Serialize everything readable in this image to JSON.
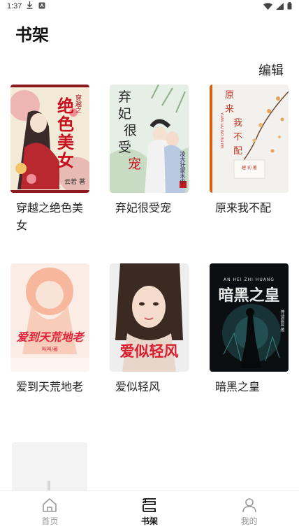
{
  "status_bar": {
    "time": "1:37"
  },
  "header": {
    "title": "书架",
    "edit_label": "编辑"
  },
  "books": [
    {
      "title": "穿越之绝色美女",
      "cover_text": [
        "绝",
        "色",
        "美",
        "女"
      ],
      "cover_top": "穿越之",
      "cover_author": "云若 著"
    },
    {
      "title": "弃妃很受宠",
      "cover_text": [
        "弃",
        "妃",
        "很",
        "受",
        "宠"
      ],
      "cover_side": "凌大壮家木中"
    },
    {
      "title": "原来我不配",
      "cover_text": [
        "原",
        "来",
        "我",
        "不",
        "配"
      ],
      "cover_pinyin": "YUAN LAI WO BU PEI",
      "cover_author": "碧 初 著"
    },
    {
      "title": "爱到天荒地老",
      "cover_text": "爱到天荒地老",
      "cover_author": "叫叫/著"
    },
    {
      "title": "爱似轻风",
      "cover_text": "爱似轻风"
    },
    {
      "title": "暗黑之皇",
      "cover_text": "暗黑之皇",
      "cover_pinyin": "AN HEI ZHI HUANG",
      "cover_author": "神话复复 著"
    }
  ],
  "tabs": [
    {
      "label": "首页",
      "icon": "home-icon",
      "active": false
    },
    {
      "label": "书架",
      "icon": "bookshelf-icon",
      "active": true
    },
    {
      "label": "我的",
      "icon": "user-icon",
      "active": false
    }
  ]
}
